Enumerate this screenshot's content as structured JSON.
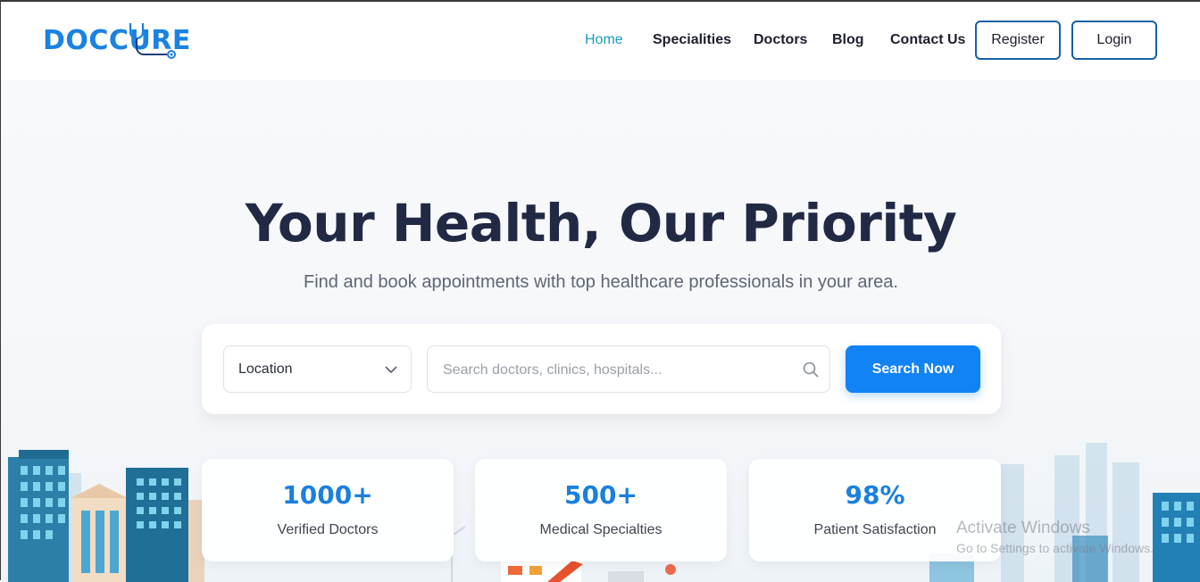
{
  "brand": {
    "name": "DOCCURE",
    "accent": "#1a82e2"
  },
  "nav": {
    "items": [
      {
        "label": "Home",
        "active": true
      },
      {
        "label": "Specialities"
      },
      {
        "label": "Doctors"
      },
      {
        "label": "Blog"
      },
      {
        "label": "Contact Us"
      }
    ],
    "register_label": "Register",
    "login_label": "Login"
  },
  "hero": {
    "title": "Your Health, Our Priority",
    "subtitle": "Find and book appointments with top healthcare professionals in your area."
  },
  "search": {
    "location_value": "Location",
    "placeholder": "Search doctors, clinics, hospitals...",
    "button_label": "Search Now",
    "icons": {
      "dropdown": "chevron-down-icon",
      "search": "search-icon"
    }
  },
  "stats": [
    {
      "value": "1000+",
      "label": "Verified Doctors"
    },
    {
      "value": "500+",
      "label": "Medical Specialties"
    },
    {
      "value": "98%",
      "label": "Patient Satisfaction"
    }
  ],
  "watermark": {
    "line1": "Activate Windows",
    "line2": "Go to Settings to activate Windows."
  }
}
